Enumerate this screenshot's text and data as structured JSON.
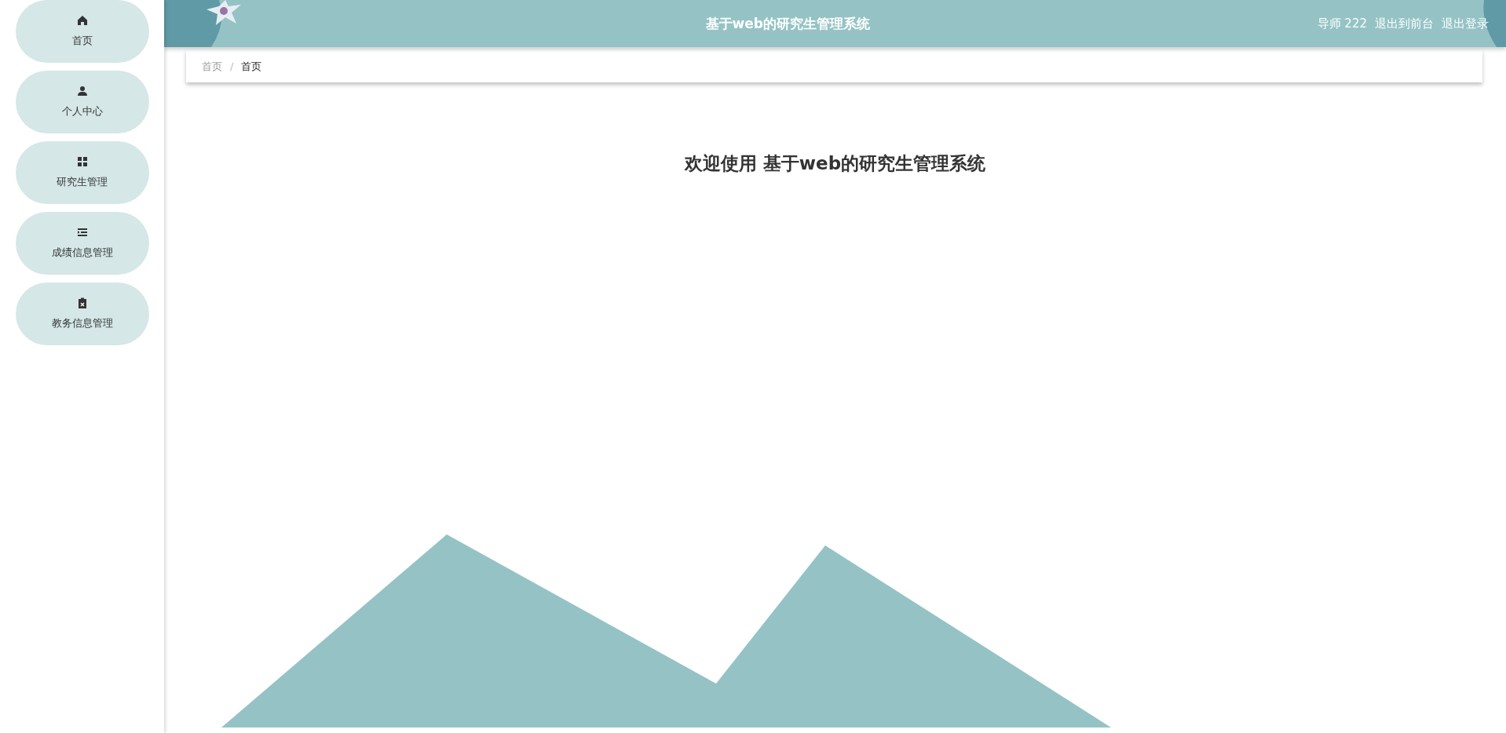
{
  "sidebar": {
    "items": [
      {
        "label": "首页"
      },
      {
        "label": "个人中心"
      },
      {
        "label": "研究生管理"
      },
      {
        "label": "成绩信息管理"
      },
      {
        "label": "教务信息管理"
      }
    ]
  },
  "header": {
    "title": "基于web的研究生管理系统",
    "user": "导师 222",
    "links": [
      "退出到前台",
      "退出登录"
    ]
  },
  "breadcrumb": {
    "separator": "/",
    "items": [
      {
        "label": "首页",
        "current": false
      },
      {
        "label": "首页",
        "current": true
      }
    ]
  },
  "welcome": {
    "title": "欢迎使用 基于web的研究生管理系统"
  }
}
